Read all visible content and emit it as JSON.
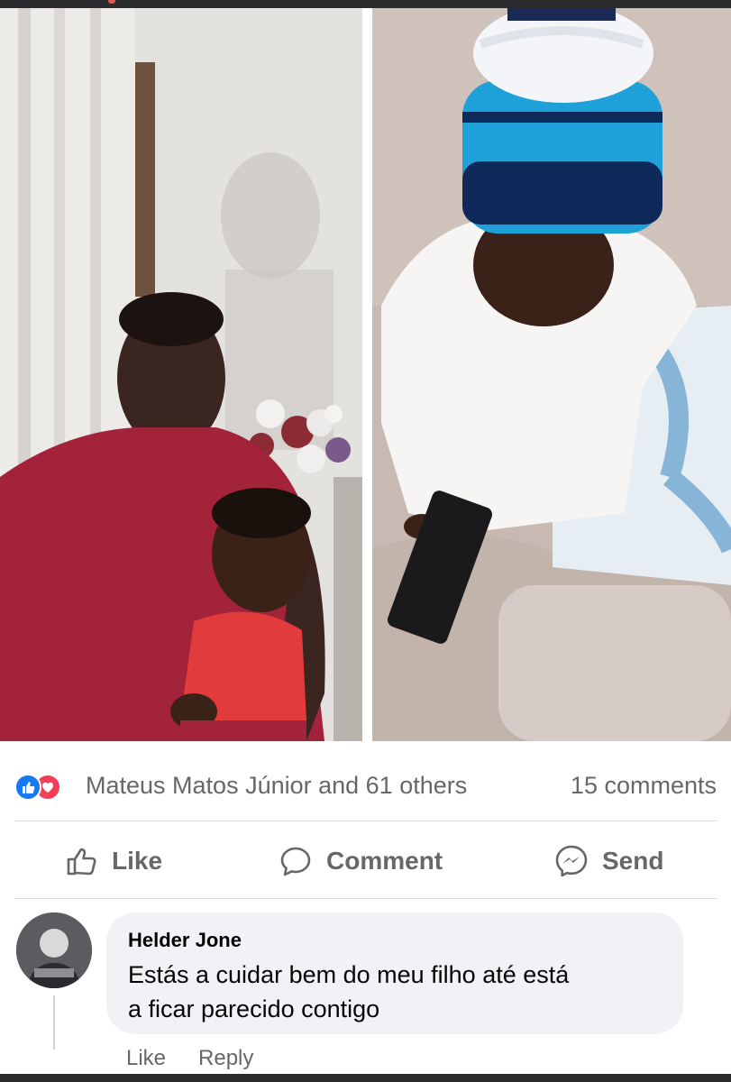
{
  "post": {
    "photos": [
      {
        "icon": "photo-man-holding-toddler"
      },
      {
        "icon": "photo-toddler-in-beanie"
      }
    ]
  },
  "reactions": {
    "icons": [
      "like-reaction-icon",
      "love-reaction-icon"
    ],
    "summary": "Mateus Matos Júnior and 61 others",
    "comments_count": "15 comments"
  },
  "actions": {
    "like_label": "Like",
    "comment_label": "Comment",
    "send_label": "Send"
  },
  "comment": {
    "author": "Helder Jone",
    "text_line1": "Estás a cuidar bem do meu filho até está",
    "text_line2": "a ficar parecido contigo",
    "like_label": "Like",
    "reply_label": "Reply"
  },
  "colors": {
    "like_blue": "#1877f2",
    "love_red": "#f33e58",
    "secondary_text": "#65676b",
    "bubble_bg": "#f0f2f5"
  }
}
